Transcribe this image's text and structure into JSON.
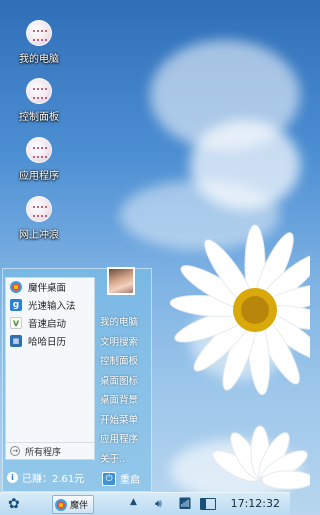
{
  "desktop": {
    "icons": [
      {
        "label": "我的电脑",
        "icon": "my-computer-icon"
      },
      {
        "label": "控制面板",
        "icon": "control-panel-icon"
      },
      {
        "label": "应用程序",
        "icon": "applications-icon"
      },
      {
        "label": "网上冲浪",
        "icon": "internet-icon"
      }
    ]
  },
  "start_menu": {
    "pinned": [
      {
        "label": "魔伴桌面",
        "icon": "mobanzhuomian-icon"
      },
      {
        "label": "光速输入法",
        "icon": "input-method-icon"
      },
      {
        "label": "音速启动",
        "icon": "launcher-icon"
      },
      {
        "label": "哈哈日历",
        "icon": "calendar-icon"
      }
    ],
    "all_programs_label": "所有程序",
    "right_items": [
      "我的电脑",
      "文明搜索",
      "控制面板",
      "桌面图标",
      "桌面背景",
      "开始菜单",
      "应用程序",
      "关于.."
    ],
    "earned_label": "已赚：2.61元",
    "restart_label": "重启"
  },
  "taskbar": {
    "task_label": "魔伴",
    "clock": "17:12:32",
    "tray_up": "▲"
  }
}
